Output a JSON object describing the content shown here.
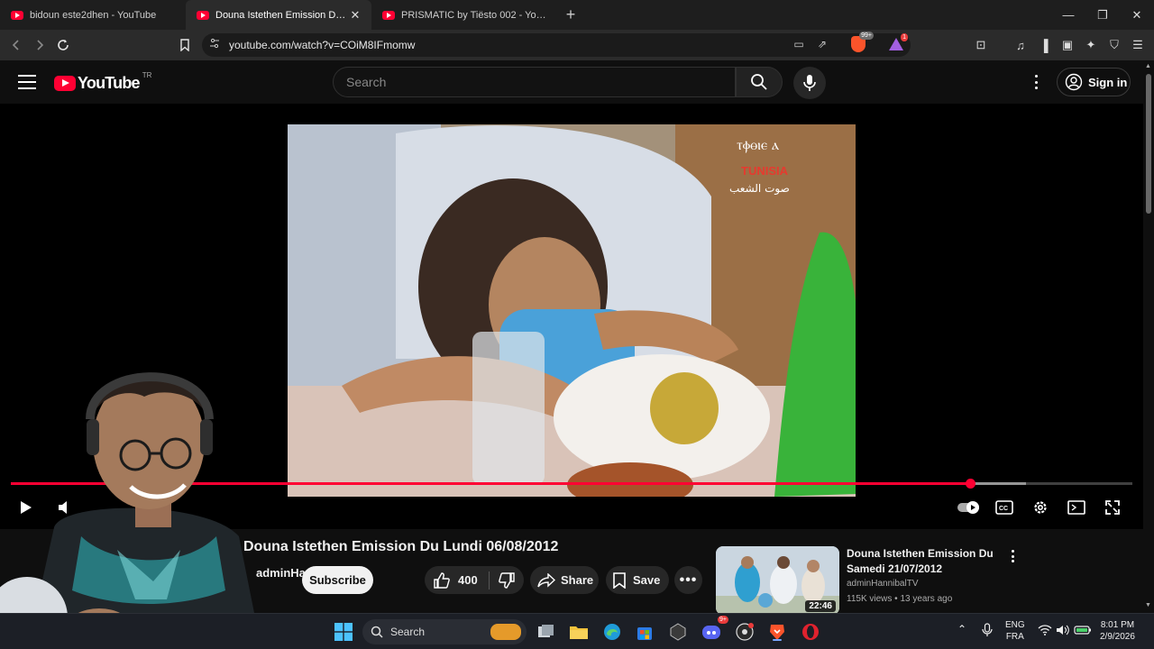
{
  "browser": {
    "tabs": [
      {
        "title": "bidoun este2dhen - YouTube",
        "active": false
      },
      {
        "title": "Douna Istethen Emission Du Lundi 06/08/2012",
        "active": true
      },
      {
        "title": "PRISMATIC by Tiësto 002 - YouTube",
        "active": false
      }
    ],
    "url": "youtube.com/watch?v=COiM8IFmomw",
    "brave_badge": "99+",
    "rewards_badge": "1"
  },
  "masthead": {
    "logo_text": "YouTube",
    "country_code": "TR",
    "search_placeholder": "Search",
    "signin_label": "Sign in"
  },
  "player": {
    "progress_fraction": 0.855,
    "buffer_fraction": 0.905,
    "overlay_text": "TUNISIA",
    "overlay_arabic": "صوت الشعب"
  },
  "video": {
    "title": "Douna Istethen Emission Du Lundi 06/08/2012",
    "channel": "adminHannibalTV",
    "subscribe_label": "Subscribe",
    "like_count": "400",
    "share_label": "Share",
    "save_label": "Save",
    "more_label": "•••"
  },
  "recommendation": {
    "title": "Douna Istethen Emission Du Samedi 21/07/2012",
    "channel": "adminHannibalTV",
    "meta": "115K views • 13 years ago",
    "duration": "22:46"
  },
  "taskbar": {
    "search_label": "Search",
    "lang_top": "ENG",
    "lang_bottom": "FRA",
    "time": "8:01 PM",
    "date": "2/9/2026",
    "discord_badge": "9+"
  },
  "colors": {
    "accent": "#ff0033",
    "background": "#0f0f0f",
    "pill": "#272727"
  }
}
